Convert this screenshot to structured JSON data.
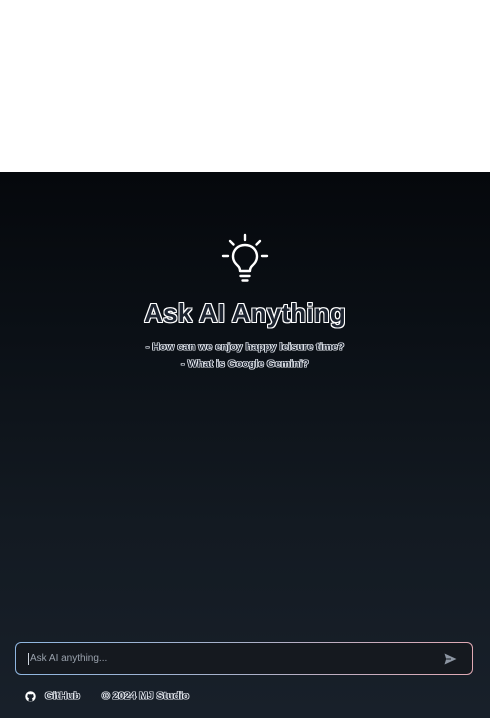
{
  "hero": {
    "title": "Ask AI Anything",
    "examples": [
      "- How can we enjoy happy leisure time?",
      "- What is Google Gemini?"
    ],
    "icon": "lightbulb-icon"
  },
  "prompt": {
    "placeholder": "Ask AI anything...",
    "value": "",
    "send_icon": "send-icon"
  },
  "footer": {
    "github_label": "GitHub",
    "github_icon": "github-icon",
    "copyright": "© 2024 MJ Studio"
  },
  "colors": {
    "background_top": "#05080c",
    "background_bottom": "#18202a",
    "input_border_left": "#8fb6e0",
    "input_border_right": "#e0a9b4"
  }
}
